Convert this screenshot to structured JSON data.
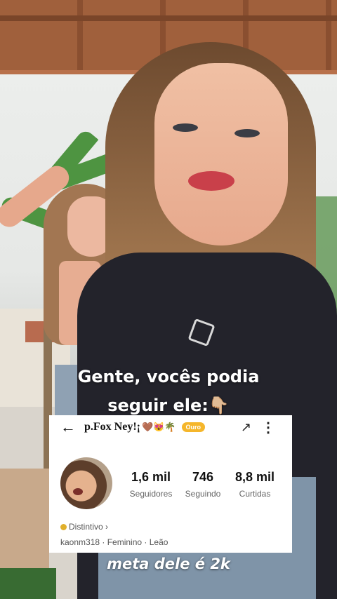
{
  "caption": {
    "line1": "Gente, vocês podia",
    "line2": "seguir ele:",
    "line2_emoji": "👇🏼",
    "bottom": "meta dele é 2k"
  },
  "profile": {
    "back_icon": "←",
    "username": "p.Fox Ney!¡",
    "username_emojis": "🤎😻🌴",
    "level_badge": "Ouro",
    "share_icon": "↗",
    "more_icon": "⋮",
    "stats": [
      {
        "value": "1,6 mil",
        "label": "Seguidores"
      },
      {
        "value": "746",
        "label": "Seguindo"
      },
      {
        "value": "8,8 mil",
        "label": "Curtidas"
      }
    ],
    "distintivo": "Distintivo ›",
    "meta": "kaonm318 · Feminino · Leão"
  },
  "colors": {
    "badge": "#f5b62b",
    "caption_text": "#ffffff"
  }
}
